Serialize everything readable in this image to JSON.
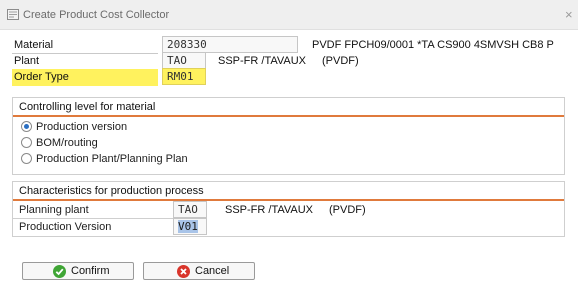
{
  "window": {
    "title": "Create Product Cost Collector",
    "close_glyph": "×"
  },
  "header_fields": {
    "material": {
      "label": "Material",
      "value": "208330",
      "description": "PVDF FPCH09/0001 *TA CS900 4SMVSH CB8 P"
    },
    "plant": {
      "label": "Plant",
      "value": "TAO",
      "name": "SSP-FR  /TAVAUX",
      "code": "(PVDF)"
    },
    "order_type": {
      "label": "Order Type",
      "value": "RM01"
    }
  },
  "controlling_group": {
    "title": "Controlling level for material",
    "options": [
      {
        "label": "Production version",
        "selected": true
      },
      {
        "label": "BOM/routing",
        "selected": false
      },
      {
        "label": "Production Plant/Planning Plan",
        "selected": false
      }
    ]
  },
  "characteristics_group": {
    "title": "Characteristics for production process",
    "planning_plant": {
      "label": "Planning plant",
      "value": "TAO",
      "name": "SSP-FR  /TAVAUX",
      "code": "(PVDF)"
    },
    "production_version": {
      "label": "Production Version",
      "value": "V01"
    }
  },
  "buttons": {
    "confirm": {
      "label": "Confirm",
      "icon": "check-circle-icon"
    },
    "cancel": {
      "label": "Cancel",
      "icon": "cancel-circle-icon"
    }
  },
  "colors": {
    "highlight": "#fff25e",
    "group_rule": "#e07a3c",
    "confirm_icon": "#3fa535",
    "cancel_icon": "#d9352b",
    "selection": "#a9c4e8"
  }
}
